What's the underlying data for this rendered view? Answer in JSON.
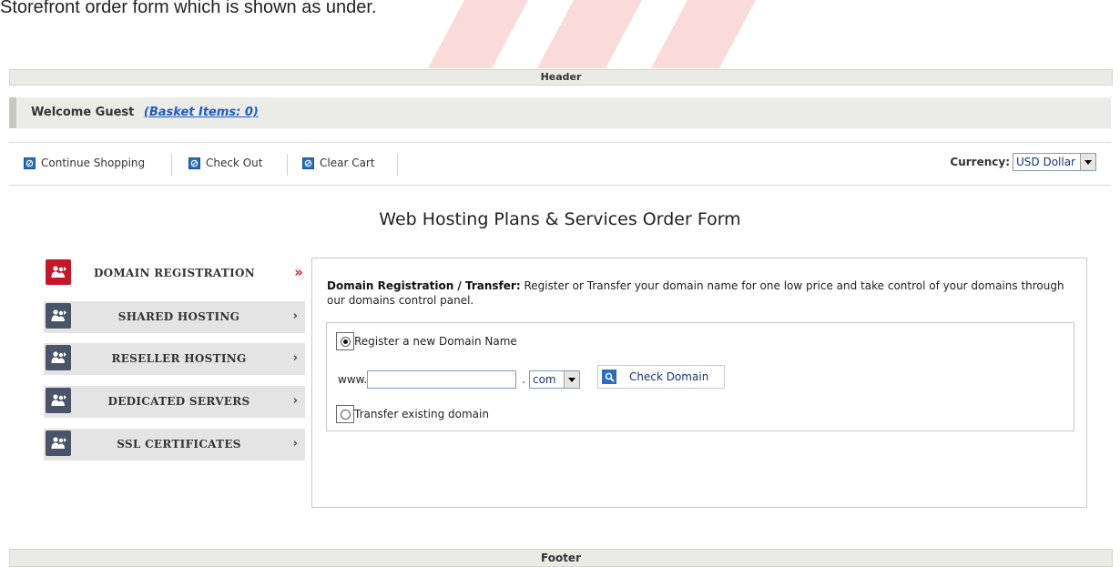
{
  "intro_text": "Storefront order form which is shown as under.",
  "header_label": "Header",
  "footer_label": "Footer",
  "welcome": {
    "text": "Welcome Guest",
    "basket": "(Basket Items: 0)"
  },
  "toolbar": {
    "continue_label": "Continue Shopping",
    "checkout_label": "Check Out",
    "clear_label": "Clear Cart",
    "currency_label": "Currency:",
    "currency_value": "USD Dollar"
  },
  "page_title": "Web Hosting Plans & Services Order Form",
  "tabs": [
    {
      "label": "DOMAIN REGISTRATION",
      "chevron": "»",
      "active": true
    },
    {
      "label": "SHARED HOSTING",
      "chevron": "›",
      "active": false
    },
    {
      "label": "RESELLER HOSTING",
      "chevron": "›",
      "active": false
    },
    {
      "label": "DEDICATED SERVERS",
      "chevron": "›",
      "active": false
    },
    {
      "label": "SSL CERTIFICATES",
      "chevron": "›",
      "active": false
    }
  ],
  "panel": {
    "desc_bold": "Domain Registration / Transfer:",
    "desc_text": " Register or Transfer your domain name for one low price and take control of your domains through our domains control panel.",
    "register_label": "Register a new Domain Name",
    "www_prefix": "www.",
    "dot": ".",
    "tld_value": "com",
    "check_label": "Check Domain",
    "transfer_label": "Transfer existing domain"
  },
  "colors": {
    "accent_red": "#c4182a",
    "tab_icon": "#4a5468",
    "link_blue": "#1f5cc2"
  }
}
